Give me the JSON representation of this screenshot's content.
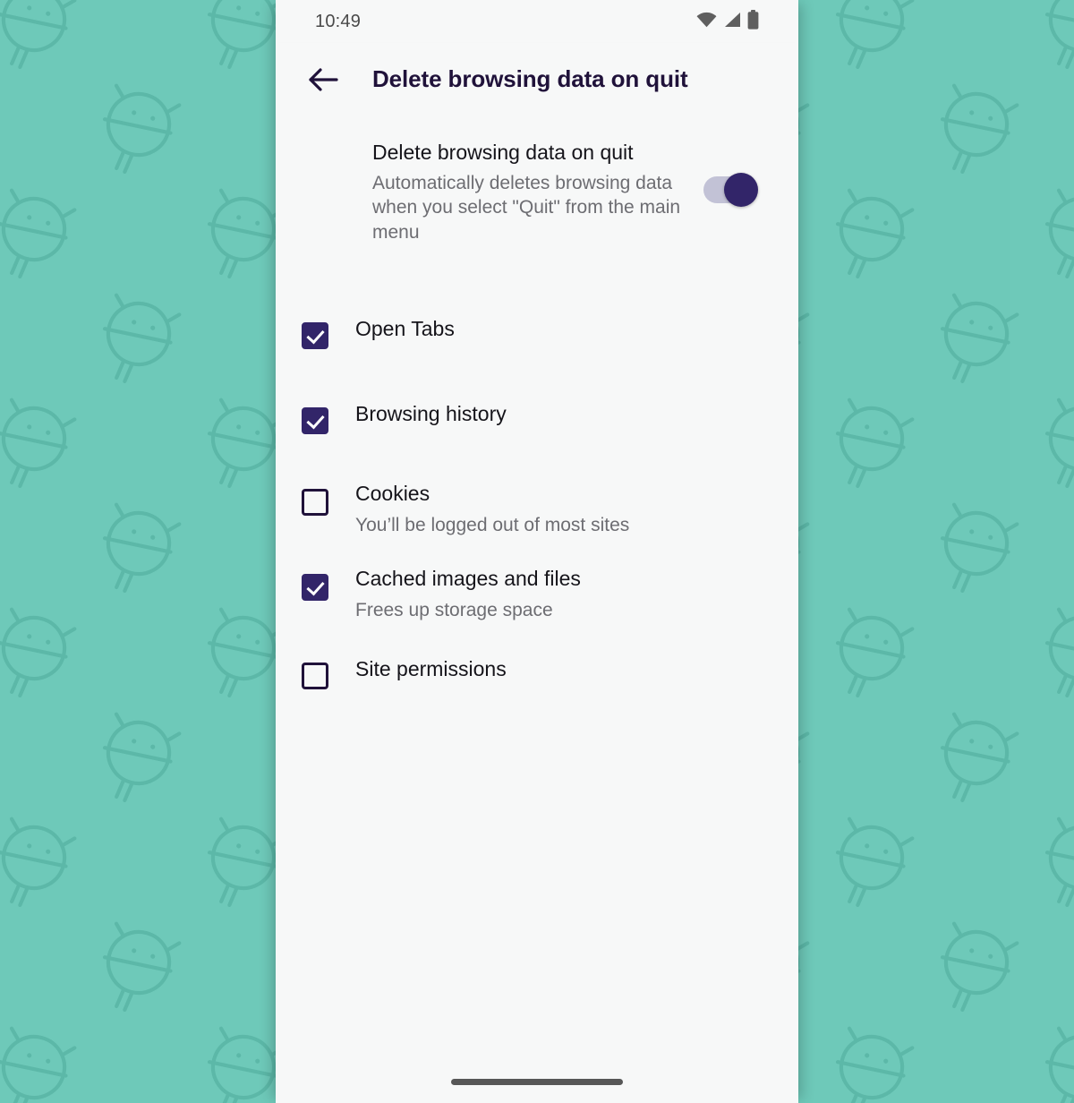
{
  "wallpaper": {
    "background_color": "#6ec9b9",
    "pattern_color": "#5cb8a8",
    "pattern_icon": "ladybug-icon"
  },
  "status_bar": {
    "time": "10:49",
    "icons": [
      "wifi-icon",
      "cellular-signal-icon",
      "battery-icon"
    ],
    "icon_color": "#5f5f5f"
  },
  "app_bar": {
    "back_label": "←",
    "title": "Delete browsing data on quit",
    "title_color": "#20123a"
  },
  "preference": {
    "title": "Delete browsing data on quit",
    "summary": "Automatically deletes browsing data when you select \"Quit\" from the main menu",
    "toggle": {
      "state": "on",
      "track_color": "#c2c2d6",
      "knob_color": "#322569"
    }
  },
  "checkboxes": [
    {
      "label": "Open Tabs",
      "summary": "",
      "checked": true
    },
    {
      "label": "Browsing history",
      "summary": "",
      "checked": true
    },
    {
      "label": "Cookies",
      "summary": "You’ll be logged out of most sites",
      "checked": false
    },
    {
      "label": "Cached images and files",
      "summary": "Frees up storage space",
      "checked": true
    },
    {
      "label": "Site permissions",
      "summary": "",
      "checked": false
    }
  ],
  "nav_bar": {
    "home_indicator": "home-indicator",
    "color": "#575757"
  },
  "theme": {
    "accent": "#322569",
    "surface": "#f7f8f8",
    "text_primary": "#15141a",
    "text_secondary": "#6d6d72"
  }
}
